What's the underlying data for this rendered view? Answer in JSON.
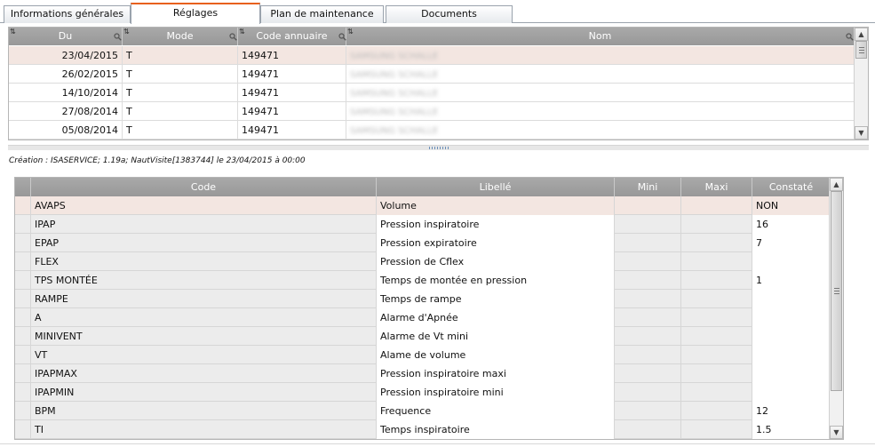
{
  "tabs": [
    {
      "label": "Informations générales",
      "active": false
    },
    {
      "label": "Réglages",
      "active": true
    },
    {
      "label": "Plan de maintenance",
      "active": false
    },
    {
      "label": "Documents",
      "active": false
    }
  ],
  "visits_table": {
    "columns": [
      "Du",
      "Mode",
      "Code annuaire",
      "Nom"
    ],
    "rows": [
      {
        "du": "23/04/2015",
        "mode": "T",
        "code": "149471",
        "nom": "SAMSUNG SCHALLE",
        "selected": true
      },
      {
        "du": "26/02/2015",
        "mode": "T",
        "code": "149471",
        "nom": "SAMSUNG SCHALLE",
        "selected": false
      },
      {
        "du": "14/10/2014",
        "mode": "T",
        "code": "149471",
        "nom": "SAMSUNG SCHALLE",
        "selected": false
      },
      {
        "du": "27/08/2014",
        "mode": "T",
        "code": "149471",
        "nom": "SAMSUNG SCHALLE",
        "selected": false
      },
      {
        "du": "05/08/2014",
        "mode": "T",
        "code": "149471",
        "nom": "SAMSUNG SCHALLE",
        "selected": false
      }
    ]
  },
  "creation_info": "Création : ISASERVICE; 1.19a; NautVisite[1383744] le 23/04/2015 à 00:00",
  "settings_table": {
    "columns": [
      "Code",
      "Libellé",
      "Mini",
      "Maxi",
      "Constaté"
    ],
    "rows": [
      {
        "code": "AVAPS",
        "libelle": "Volume",
        "mini": "",
        "maxi": "",
        "constate": "NON",
        "selected": true
      },
      {
        "code": "IPAP",
        "libelle": "Pression inspiratoire",
        "mini": "",
        "maxi": "",
        "constate": "16",
        "selected": false
      },
      {
        "code": "EPAP",
        "libelle": "Pression expiratoire",
        "mini": "",
        "maxi": "",
        "constate": "7",
        "selected": false
      },
      {
        "code": "FLEX",
        "libelle": "Pression de Cflex",
        "mini": "",
        "maxi": "",
        "constate": "",
        "selected": false
      },
      {
        "code": "TPS MONTÉE",
        "libelle": "Temps de montée en pression",
        "mini": "",
        "maxi": "",
        "constate": "1",
        "selected": false
      },
      {
        "code": "RAMPE",
        "libelle": "Temps de rampe",
        "mini": "",
        "maxi": "",
        "constate": "",
        "selected": false
      },
      {
        "code": "A",
        "libelle": "Alarme d'Apnée",
        "mini": "",
        "maxi": "",
        "constate": "",
        "selected": false
      },
      {
        "code": "MINIVENT",
        "libelle": "Alarme de Vt mini",
        "mini": "",
        "maxi": "",
        "constate": "",
        "selected": false
      },
      {
        "code": "VT",
        "libelle": "Alame de volume",
        "mini": "",
        "maxi": "",
        "constate": "",
        "selected": false
      },
      {
        "code": "IPAPMAX",
        "libelle": "Pression inspiratoire maxi",
        "mini": "",
        "maxi": "",
        "constate": "",
        "selected": false
      },
      {
        "code": "IPAPMIN",
        "libelle": "Pression inspiratoire mini",
        "mini": "",
        "maxi": "",
        "constate": "",
        "selected": false
      },
      {
        "code": "BPM",
        "libelle": "Frequence",
        "mini": "",
        "maxi": "",
        "constate": "12",
        "selected": false
      },
      {
        "code": "TI",
        "libelle": "Temps inspiratoire",
        "mini": "",
        "maxi": "",
        "constate": "1.5",
        "selected": false
      }
    ]
  },
  "colors": {
    "header_bg": "#a0a0a0",
    "selected_row": "#f3e6e1",
    "active_tab_accent": "#e8601c"
  }
}
